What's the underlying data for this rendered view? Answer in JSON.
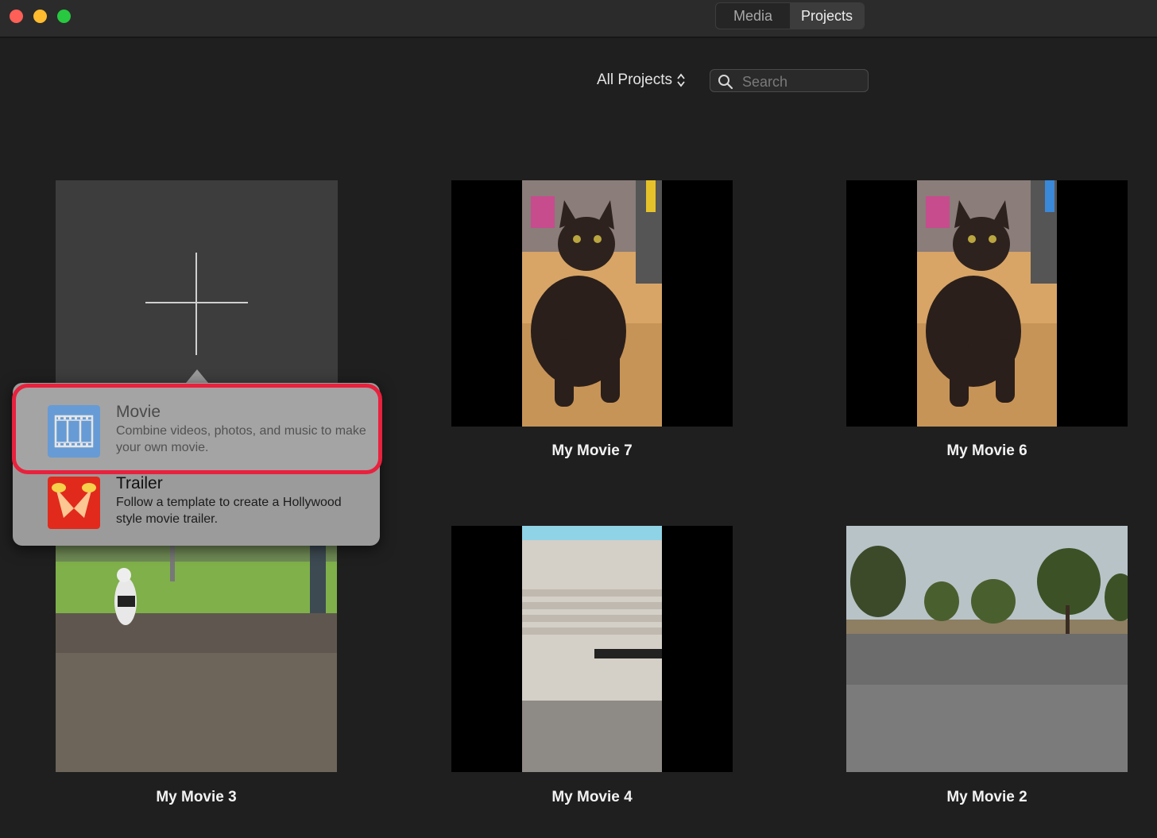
{
  "toolbar": {
    "tabs": [
      {
        "label": "Media",
        "active": false
      },
      {
        "label": "Projects",
        "active": true
      }
    ]
  },
  "browser": {
    "filter_label": "All Projects",
    "search_placeholder": "Search"
  },
  "popup": {
    "options": [
      {
        "title": "Movie",
        "description": "Combine videos, photos, and music to make your own movie.",
        "icon": "film-strip-icon",
        "highlighted": true
      },
      {
        "title": "Trailer",
        "description": "Follow a template to create a Hollywood style movie trailer.",
        "icon": "trailer-spotlight-icon",
        "highlighted": false
      }
    ]
  },
  "projects": [
    {
      "title": "My Movie 7"
    },
    {
      "title": "My Movie 6"
    },
    {
      "title": "My Movie 3"
    },
    {
      "title": "My Movie 4"
    },
    {
      "title": "My Movie 2"
    }
  ],
  "colors": {
    "highlight": "#e8213d",
    "movie_icon": "#3d8ee6",
    "trailer_icon": "#e12a1c"
  }
}
